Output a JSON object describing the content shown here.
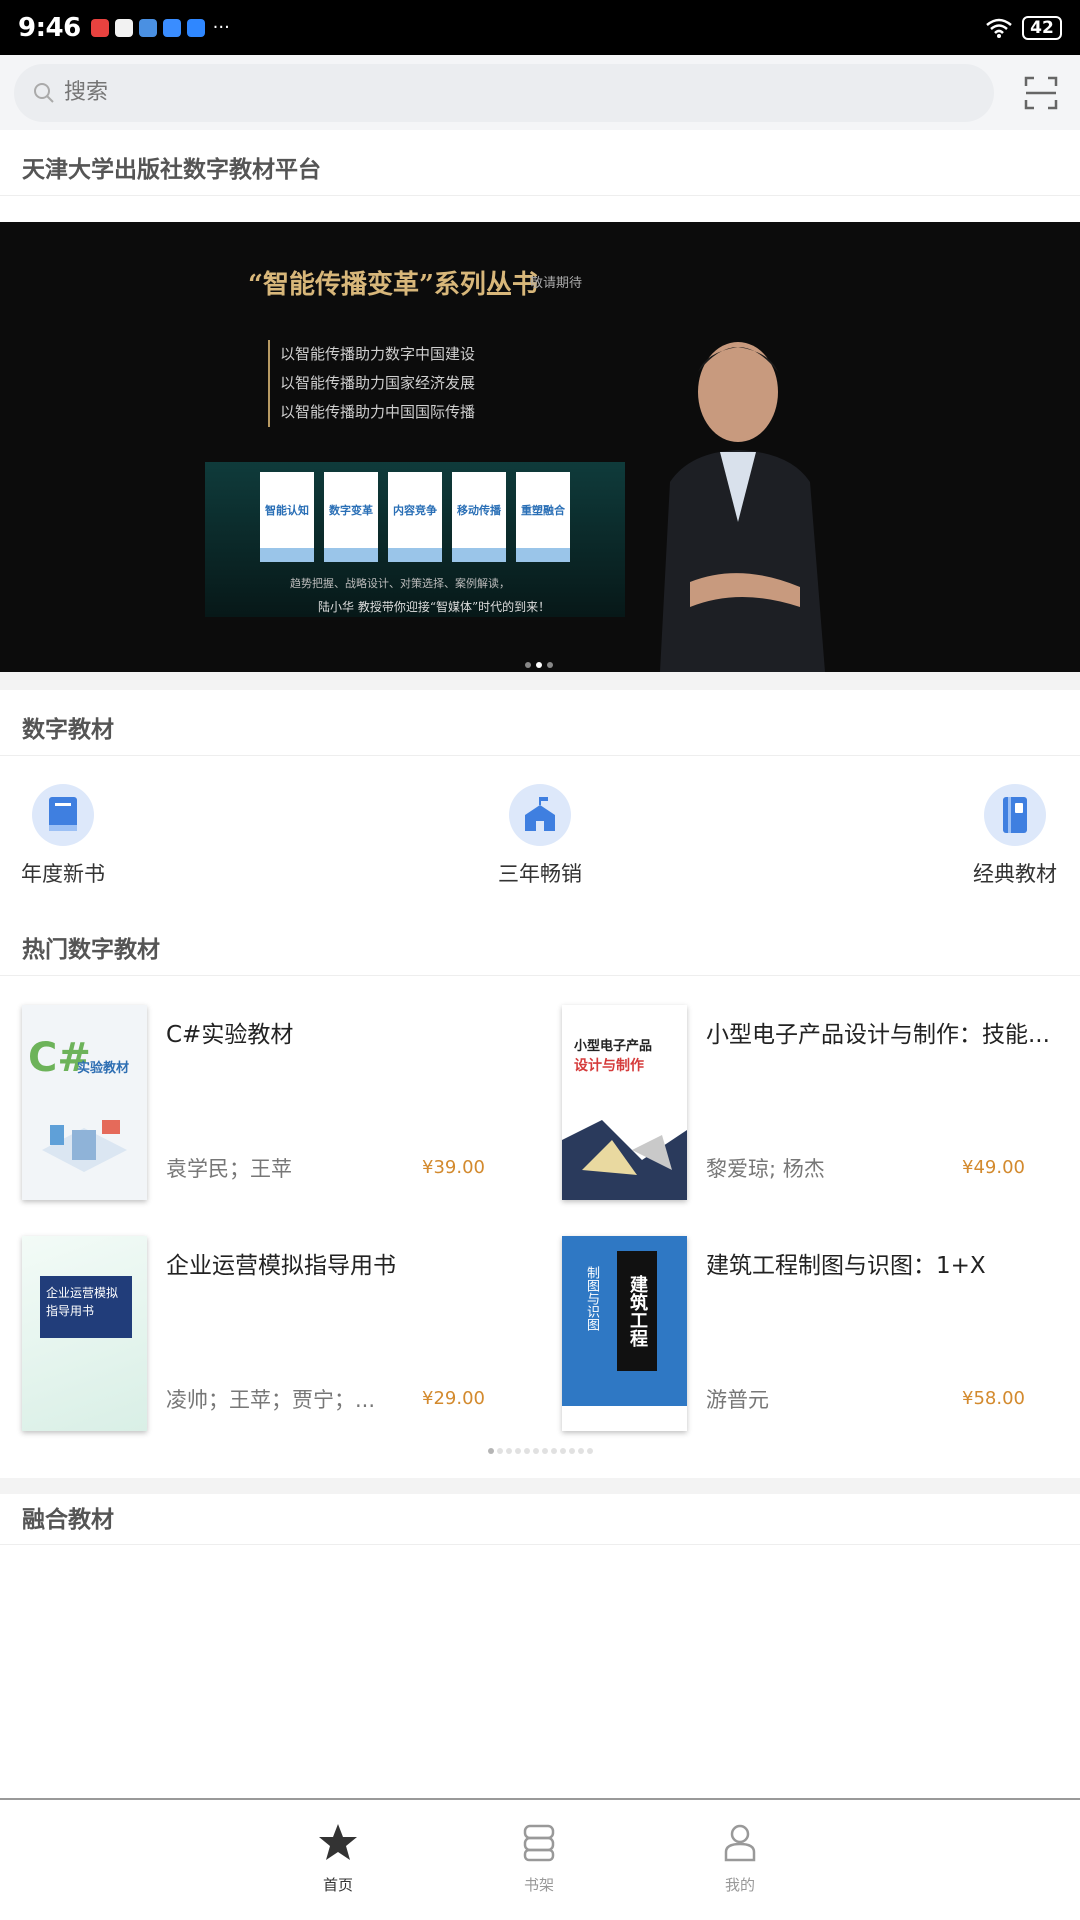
{
  "status_bar": {
    "time": "9:46",
    "more": "···",
    "battery": "42"
  },
  "search": {
    "placeholder": "搜索"
  },
  "platform_title": "天津大学出版社数字教材平台",
  "banner": {
    "title": "“智能传播变革”系列丛书",
    "subtitle": "敬请期待",
    "lines": [
      "以智能传播助力数字中国建设",
      "以智能传播助力国家经济发展",
      "以智能传播助力中国国际传播"
    ],
    "book_titles": [
      "智能认知",
      "数字变革",
      "内容竞争",
      "移动传播",
      "重塑融合"
    ],
    "caption1": "趋势把握、战略设计、对策选择、案例解读，",
    "caption2": "陆小华 教授带你迎接“智媒体”时代的到来！",
    "slides": 3,
    "active_slide": 2
  },
  "digital_section": {
    "title": "数字教材",
    "categories": [
      {
        "label": "年度新书",
        "icon": "book-icon"
      },
      {
        "label": "三年畅销",
        "icon": "school-icon"
      },
      {
        "label": "经典教材",
        "icon": "notebook-icon"
      }
    ]
  },
  "hot_section": {
    "title": "热门数字教材",
    "books": [
      {
        "title": "C#实验教材",
        "author": "袁学民；王苹",
        "price": "¥39.00",
        "cover_text": "C# 实验教材"
      },
      {
        "title": "小型电子产品设计与制作：技能...",
        "author": "黎爱琼; 杨杰",
        "price": "¥49.00",
        "cover_text": "小型电子产品 设计与制作"
      },
      {
        "title": "企业运营模拟指导用书",
        "author": "凌帅；王苹；贾宁；...",
        "price": "¥29.00",
        "cover_text": "企业运营模拟 指导用书"
      },
      {
        "title": "建筑工程制图与识图：1+X",
        "author": "游普元",
        "price": "¥58.00",
        "cover_text": "建筑工程 制图与识图"
      }
    ],
    "pages": 12,
    "active_page": 1
  },
  "fusion_section": {
    "title": "融合教材"
  },
  "bottom_nav": [
    {
      "label": "首页",
      "icon": "star-icon",
      "active": true
    },
    {
      "label": "书架",
      "icon": "bookshelf-icon",
      "active": false
    },
    {
      "label": "我的",
      "icon": "person-icon",
      "active": false
    }
  ],
  "colors": {
    "price": "#d38a2e",
    "icon_bg": "#dde8fa",
    "icon_fg": "#3f7fe0",
    "banner_gold": "#d8b77a"
  }
}
